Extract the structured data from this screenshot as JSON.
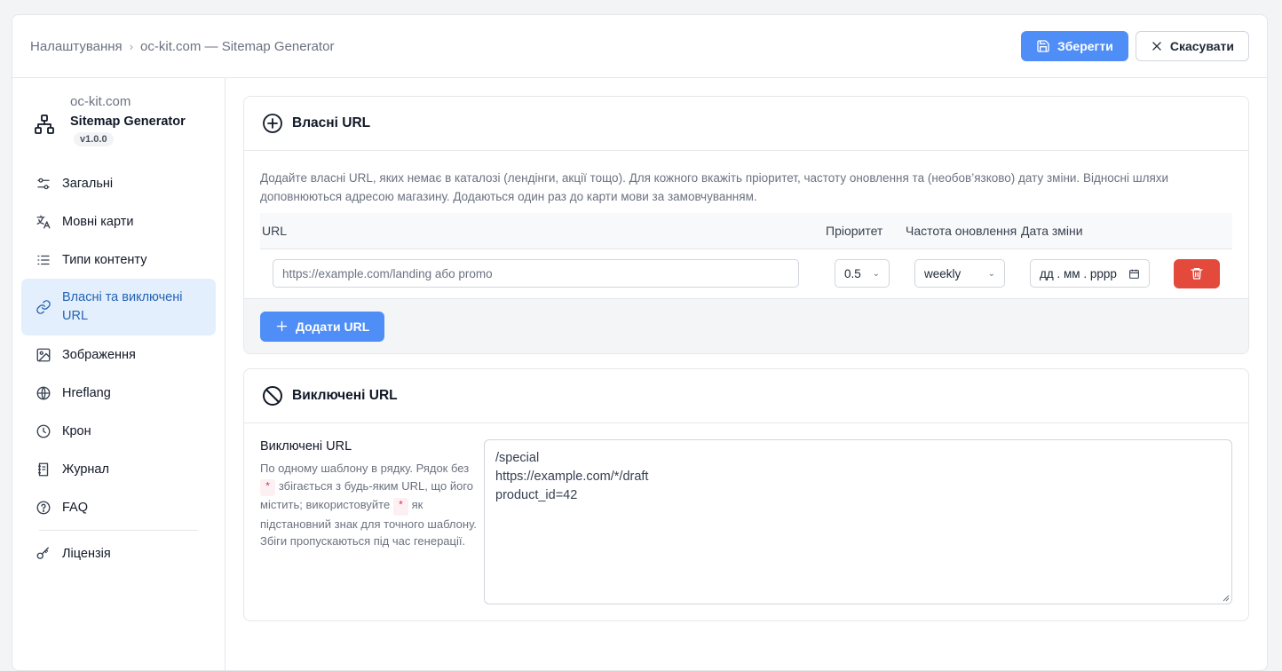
{
  "breadcrumb": {
    "root": "Налаштування",
    "sep": "›",
    "current": "oc-kit.com — Sitemap Generator"
  },
  "toolbar": {
    "save_label": "Зберегти",
    "cancel_label": "Скасувати"
  },
  "brand": {
    "site": "oc-kit.com",
    "name": "Sitemap Generator",
    "version": "v1.0.0"
  },
  "sidebar": {
    "items": [
      {
        "label": "Загальні",
        "icon": "sliders-icon"
      },
      {
        "label": "Мовні карти",
        "icon": "translate-icon"
      },
      {
        "label": "Типи контенту",
        "icon": "list-icon"
      },
      {
        "label": "Власні та виключені URL",
        "icon": "link-icon",
        "active": true
      },
      {
        "label": "Зображення",
        "icon": "image-icon"
      },
      {
        "label": "Hreflang",
        "icon": "globe-icon"
      },
      {
        "label": "Крон",
        "icon": "clock-icon"
      },
      {
        "label": "Журнал",
        "icon": "journal-icon"
      },
      {
        "label": "FAQ",
        "icon": "question-icon"
      },
      {
        "label": "Ліцензія",
        "icon": "key-icon"
      }
    ]
  },
  "custom": {
    "title": "Власні URL",
    "description": "Додайте власні URL, яких немає в каталозі (лендінги, акції тощо). Для кожного вкажіть пріоритет, частоту оновлення та (необов’язково) дату зміни. Відносні шляхи доповнюються адресою магазину. Додаються один раз до карти мови за замовчуванням.",
    "columns": {
      "url": "URL",
      "priority": "Пріоритет",
      "freq": "Частота оновлення",
      "date": "Дата зміни"
    },
    "row": {
      "url_placeholder": "https://example.com/landing або promo",
      "priority": "0.5",
      "freq": "weekly",
      "date_placeholder": "дд . мм . рррр"
    },
    "add_label": "Додати URL"
  },
  "excluded": {
    "title": "Виключені URL",
    "label": "Виключені URL",
    "help_1": "По одному шаблону в рядку. Рядок без",
    "help_2": "збігається з будь-яким URL, що його містить; використовуйте",
    "help_3": "як підстановний знак для точного шаблону. Збіги пропускаються під час генерації.",
    "wildcard": "*",
    "lines": [
      "/special",
      "https://example.com/*/draft",
      "product_id=42"
    ]
  },
  "colors": {
    "primary": "#4f8ef7",
    "danger": "#e34a3c",
    "active_bg": "#e3effc"
  }
}
